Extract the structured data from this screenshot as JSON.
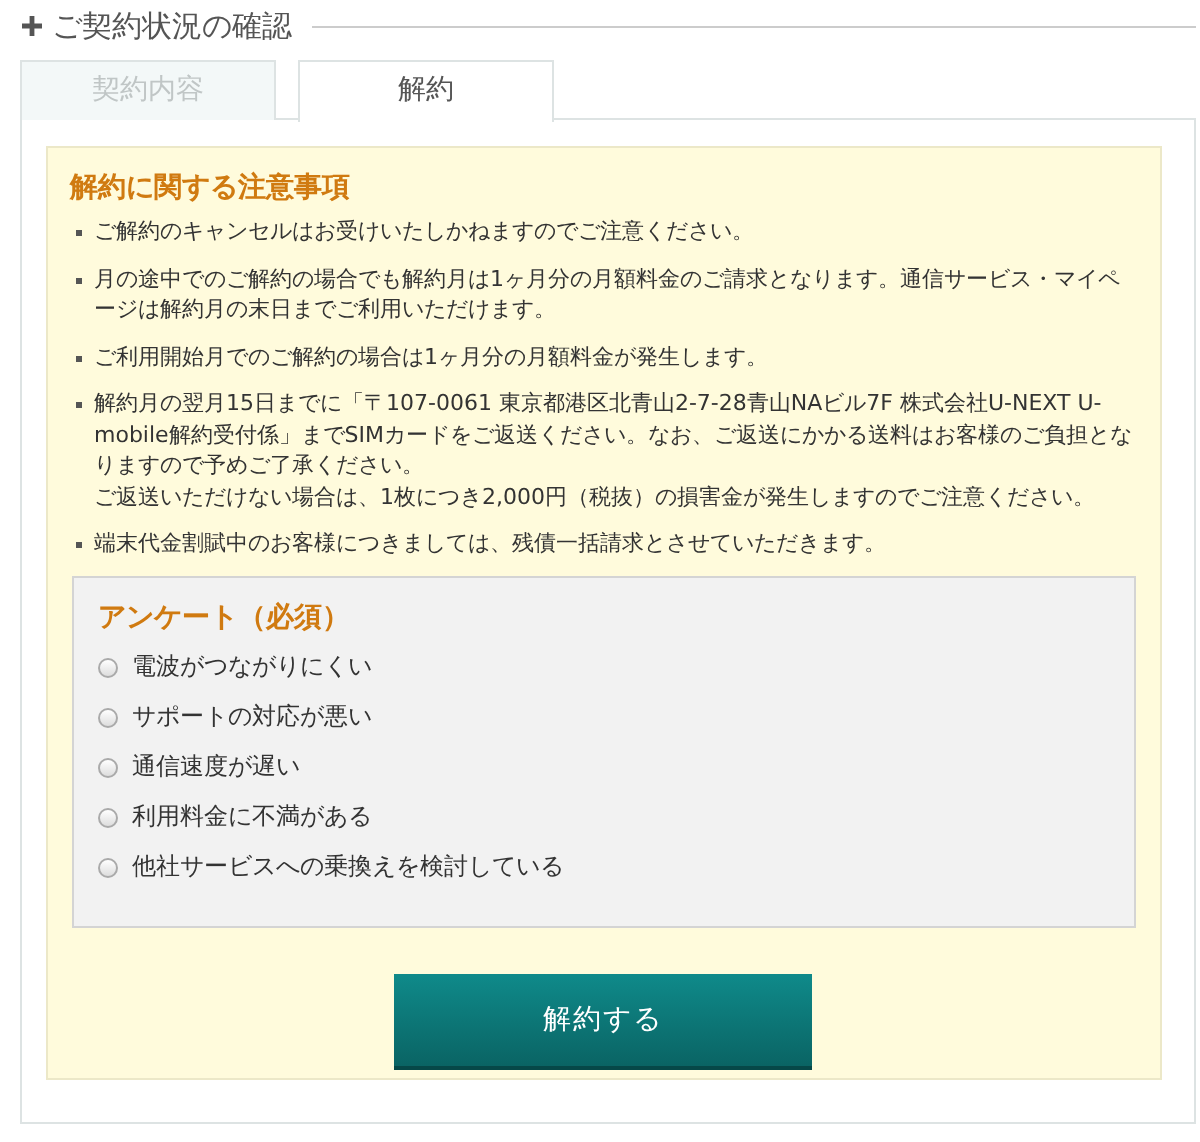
{
  "heading": "ご契約状況の確認",
  "tabs": [
    {
      "label": "契約内容",
      "selected": false
    },
    {
      "label": "解約",
      "selected": true
    }
  ],
  "notice": {
    "title": "解約に関する注意事項",
    "items": [
      [
        "ご解約のキャンセルはお受けいたしかねますのでご注意ください。"
      ],
      [
        "月の途中でのご解約の場合でも解約月は1ヶ月分の月額料金のご請求となります。通信サービス・マイページは解約月の末日までご利用いただけます。"
      ],
      [
        "ご利用開始月でのご解約の場合は1ヶ月分の月額料金が発生します。"
      ],
      [
        "解約月の翌月15日までに「〒107-0061 東京都港区北青山2-7-28青山NAビル7F 株式会社U-NEXT U-mobile解約受付係」までSIMカードをご返送ください。なお、ご返送にかかる送料はお客様のご負担となりますので予めご了承ください。",
        "ご返送いただけない場合は、1枚につき2,000円（税抜）の損害金が発生しますのでご注意ください。"
      ],
      [
        "端末代金割賦中のお客様につきましては、残債一括請求とさせていただきます。"
      ]
    ]
  },
  "survey": {
    "title": "アンケート（必須）",
    "options": [
      {
        "label": "電波がつながりにくい",
        "selected": false
      },
      {
        "label": "サポートの対応が悪い",
        "selected": false
      },
      {
        "label": "通信速度が遅い",
        "selected": false
      },
      {
        "label": "利用料金に不満がある",
        "selected": false
      },
      {
        "label": "他社サービスへの乗換えを検討している",
        "selected": false
      }
    ]
  },
  "submit_button": "解約する"
}
